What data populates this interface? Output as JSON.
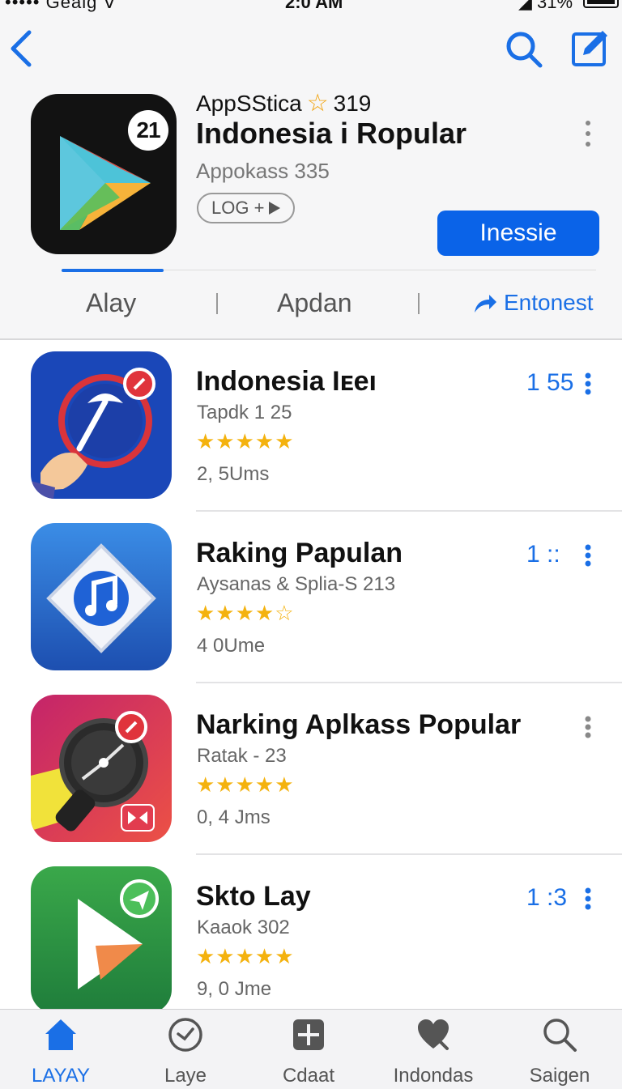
{
  "status": {
    "carrier": "••••• Geaig ᐁ",
    "time": "2:0 AM",
    "battery": "◢ 31%"
  },
  "hero": {
    "brand": "AppSStica",
    "brand_rating": "319",
    "badge": "21",
    "title": "Indonesia i Ropular",
    "developer": "Appokass 335",
    "tag": "LOG +",
    "install_label": "Inessie"
  },
  "tabs": [
    {
      "label": "Alay"
    },
    {
      "label": "Apdan"
    },
    {
      "label": "Entonest"
    }
  ],
  "apps": [
    {
      "title": "Indonesia Iᴇeı",
      "subtitle": "Tapdk 1 25",
      "stars": "★★★★★",
      "size": "2, 5Ums",
      "rank": "1 55",
      "rating": 4.5
    },
    {
      "title": "Raking Papulan",
      "subtitle": "Aysanas & Splia-S 213",
      "stars": "★★★★☆",
      "size": "4 0Ume",
      "rank": "1 ::",
      "rating": 4.5
    },
    {
      "title": "Narking Aplkass Popular",
      "subtitle": "Ratak - 23",
      "stars": "★★★★★",
      "size": "0, 4 Jms",
      "rank": "",
      "rating": 4.5
    },
    {
      "title": "Skto Lay",
      "subtitle": "Kaaok 302",
      "stars": "★★★★★",
      "size": "9, 0 Jme",
      "rank": "1 :3",
      "rating": 4.5
    }
  ],
  "tabbar": [
    {
      "label": "LAYAY",
      "icon": "home-icon"
    },
    {
      "label": "Laye",
      "icon": "clock-icon"
    },
    {
      "label": "Cdaat",
      "icon": "plus-square-icon"
    },
    {
      "label": "Indondas",
      "icon": "heart-icon"
    },
    {
      "label": "Saigen",
      "icon": "search-icon"
    }
  ],
  "colors": {
    "accent": "#1a6fe6",
    "install": "#0a63e8",
    "star": "#f4b20e"
  }
}
